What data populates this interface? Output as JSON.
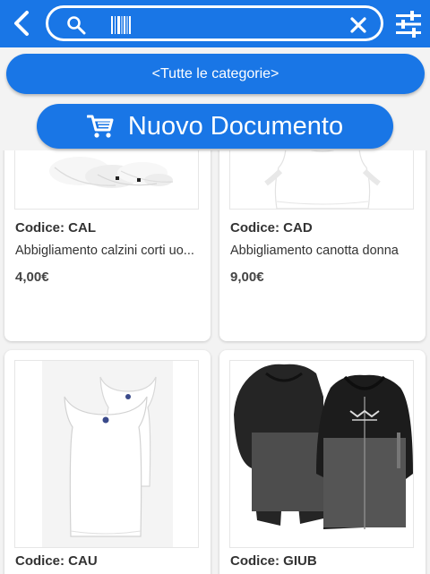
{
  "header": {
    "search": {
      "value": "",
      "placeholder": ""
    }
  },
  "filters": {
    "category_label": "<Tutte le categorie>"
  },
  "actions": {
    "new_document_label": "Nuovo Documento"
  },
  "products": [
    {
      "code": "Codice: CAL",
      "description": "Abbigliamento calzini corti uo...",
      "price": "4,00€"
    },
    {
      "code": "Codice: CAD",
      "description": "Abbigliamento canotta donna",
      "price": "9,00€"
    },
    {
      "code": "Codice: CAU",
      "description": "",
      "price": ""
    },
    {
      "code": "Codice: GIUB",
      "description": "",
      "price": ""
    }
  ],
  "colors": {
    "primary": "#1976e6",
    "background": "#f3f3f3",
    "card": "#ffffff"
  }
}
